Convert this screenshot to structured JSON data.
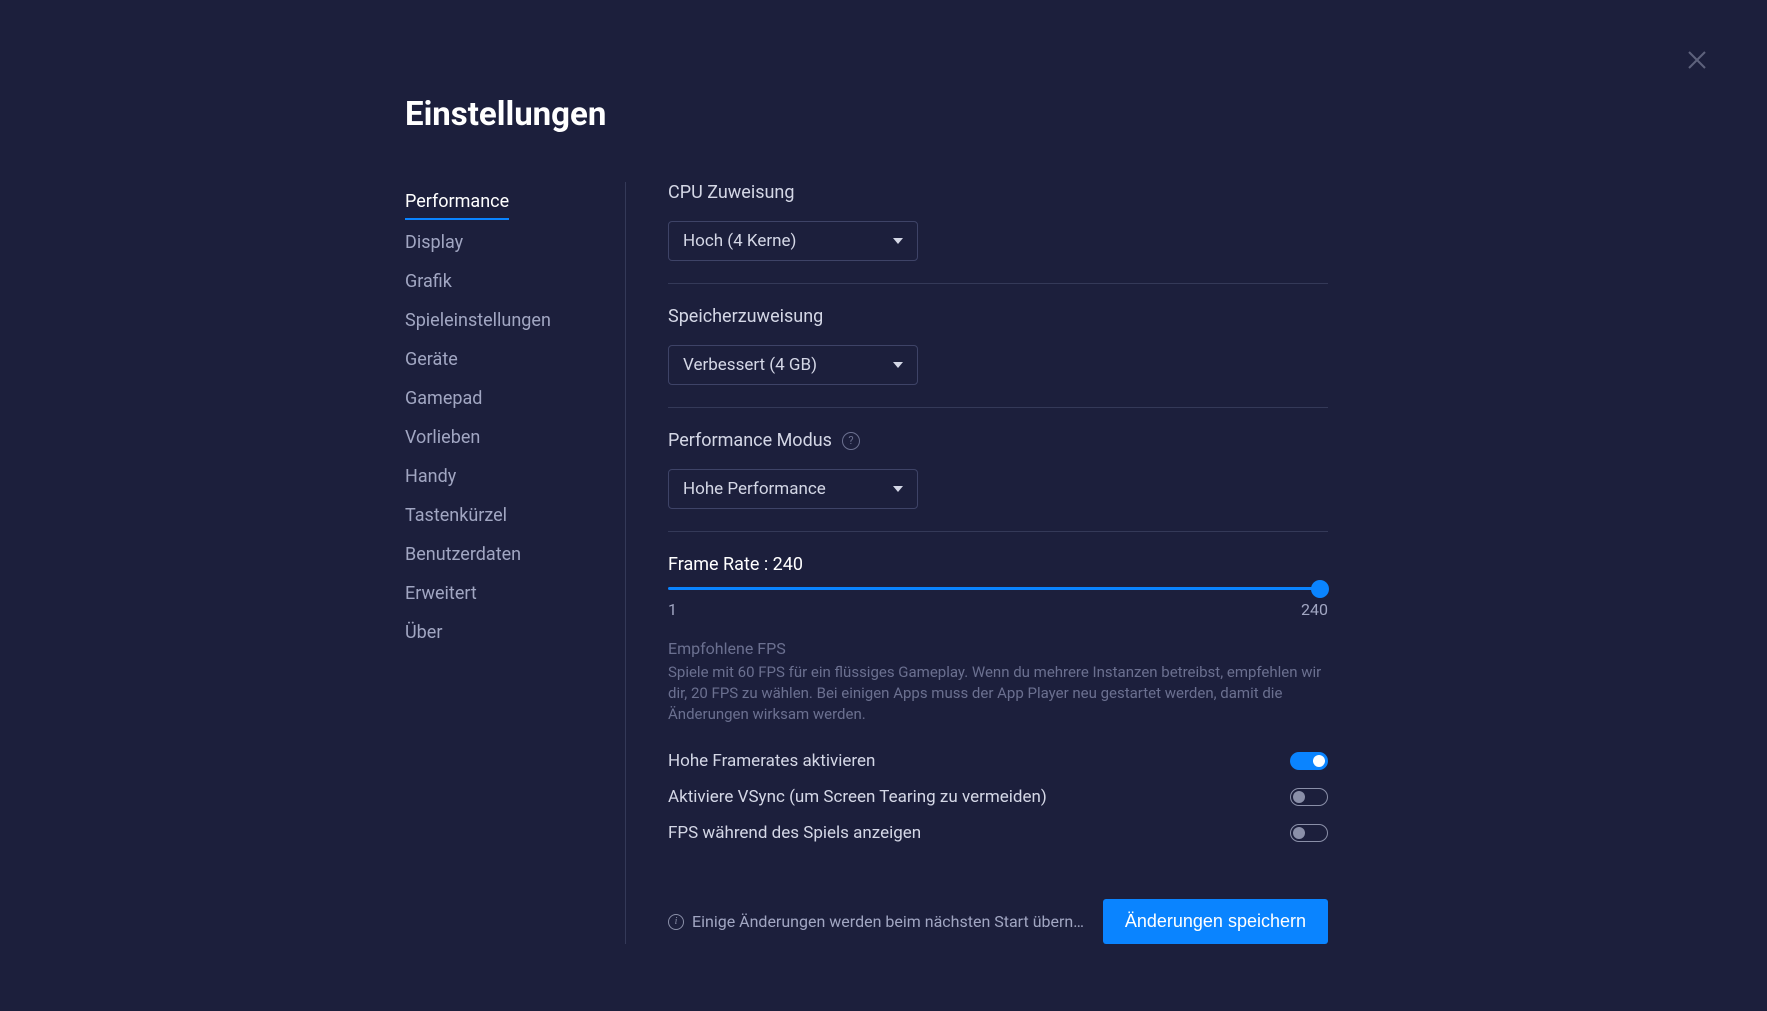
{
  "title": "Einstellungen",
  "sidebar": {
    "items": [
      {
        "label": "Performance",
        "active": true
      },
      {
        "label": "Display",
        "active": false
      },
      {
        "label": "Grafik",
        "active": false
      },
      {
        "label": "Spieleinstellungen",
        "active": false
      },
      {
        "label": "Geräte",
        "active": false
      },
      {
        "label": "Gamepad",
        "active": false
      },
      {
        "label": "Vorlieben",
        "active": false
      },
      {
        "label": "Handy",
        "active": false
      },
      {
        "label": "Tastenkürzel",
        "active": false
      },
      {
        "label": "Benutzerdaten",
        "active": false
      },
      {
        "label": "Erweitert",
        "active": false
      },
      {
        "label": "Über",
        "active": false
      }
    ]
  },
  "cpu": {
    "label": "CPU Zuweisung",
    "value": "Hoch (4 Kerne)"
  },
  "memory": {
    "label": "Speicherzuweisung",
    "value": "Verbessert (4 GB)"
  },
  "perfmode": {
    "label": "Performance Modus",
    "value": "Hohe Performance"
  },
  "framerate": {
    "label_prefix": "Frame Rate : ",
    "value": "240",
    "min": "1",
    "max": "240"
  },
  "fps_hint": {
    "title": "Empfohlene FPS",
    "text": "Spiele mit 60 FPS für ein flüssiges Gameplay. Wenn du mehrere Instanzen betreibst, empfehlen wir dir, 20 FPS zu wählen. Bei einigen Apps muss der App Player neu gestartet werden, damit die Änderungen wirksam werden."
  },
  "toggles": {
    "high_fps": {
      "label": "Hohe Framerates aktivieren",
      "on": true
    },
    "vsync": {
      "label": "Aktiviere VSync (um Screen Tearing zu vermeiden)",
      "on": false
    },
    "show_fps": {
      "label": "FPS während des Spiels anzeigen",
      "on": false
    }
  },
  "footer": {
    "info": "Einige Änderungen werden beim nächsten Start übernom…",
    "save": "Änderungen speichern"
  }
}
